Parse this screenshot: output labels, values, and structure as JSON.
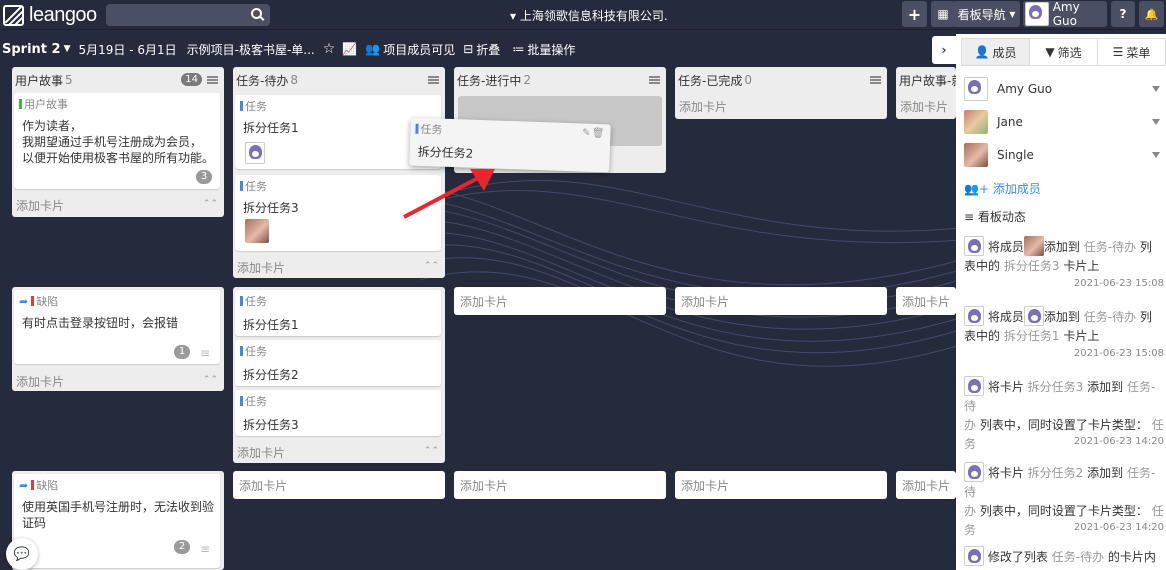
{
  "app": {
    "logo_text": "leangoo",
    "company": "上海领歌信息科技有限公司."
  },
  "topbar": {
    "plus": "+",
    "grid": "▦",
    "board_nav": "看板导航",
    "user": "Amy Guo",
    "help": "?",
    "bell": "🔔"
  },
  "sprintbar": {
    "sprint": "Sprint 2",
    "dates": "5月19日 - 6月1日",
    "project": "示例项目-极客书屋-单...",
    "visibility": "项目成员可见",
    "collapse": "折叠",
    "batch": "批量操作"
  },
  "columns": [
    {
      "title": "用户故事",
      "count": "5",
      "badge": "14"
    },
    {
      "title": "任务-待办",
      "count": "8"
    },
    {
      "title": "任务-进行中",
      "count": "2"
    },
    {
      "title": "任务-已完成",
      "count": "0"
    },
    {
      "title": "用户故事-就",
      "count": ""
    }
  ],
  "add_card": "添加卡片",
  "cards": {
    "story": {
      "type": "用户故事",
      "line1": "作为读者，",
      "line2": "我期望通过手机号注册成为会员，",
      "line3": "以便开始使用极客书屋的所有功能。",
      "num": "3"
    },
    "task1": {
      "type": "任务",
      "text": "拆分任务1"
    },
    "task3": {
      "type": "任务",
      "text": "拆分任务3"
    },
    "drag": {
      "type": "任务",
      "text": "拆分任务2"
    },
    "bug1": {
      "type": "缺陷",
      "text": "有时点击登录按钮时，会报错",
      "num": "1"
    },
    "r2t1": {
      "type": "任务",
      "text": "拆分任务1"
    },
    "r2t2": {
      "type": "任务",
      "text": "拆分任务2"
    },
    "r2t3": {
      "type": "任务",
      "text": "拆分任务3"
    },
    "bug2": {
      "type": "缺陷",
      "line1": "使用英国手机号注册时，无法收到验",
      "line2": "证码",
      "num": "2"
    }
  },
  "panel": {
    "tabs": [
      "成员",
      "筛选",
      "菜单"
    ],
    "members": [
      "Amy Guo",
      "Jane",
      "Single"
    ],
    "add_member": "添加成员",
    "activity_title": "看板动态",
    "activities": [
      {
        "l1a": "将成员",
        "l1b": "添加到",
        "l1c": "任务-待办",
        "l1d": "列",
        "l2a": "表中的",
        "l2b": "拆分任务3",
        "l2c": "卡片上",
        "time": "2021-06-23 15:08"
      },
      {
        "l1a": "将成员",
        "l1b": "添加到",
        "l1c": "任务-待办",
        "l1d": "列",
        "l2a": "表中的",
        "l2b": "拆分任务1",
        "l2c": "卡片上",
        "time": "2021-06-23 15:08"
      },
      {
        "l1a": "将卡片",
        "l1b": "拆分任务3",
        "l1c": "添加到",
        "l1d": "任务-待",
        "l2a": "办",
        "l2b": "列表中，同时设置了卡片类型：",
        "l2c": "任",
        "l3": "务",
        "time": "2021-06-23 14:20"
      },
      {
        "l1a": "将卡片",
        "l1b": "拆分任务2",
        "l1c": "添加到",
        "l1d": "任务-待",
        "l2a": "办",
        "l2b": "列表中，同时设置了卡片类型：",
        "l2c": "任",
        "l3": "务",
        "time": "2021-06-23 14:20"
      },
      {
        "l1a": "修改了列表",
        "l1b": "任务-待办",
        "l1c": "的卡片内"
      }
    ]
  },
  "colors": {
    "bg": "#262a3d",
    "story": "#3cb34a",
    "task": "#3c8ce7",
    "bug": "#e23b3b",
    "arrow": "#e8262d",
    "link": "#3c8ce7"
  }
}
